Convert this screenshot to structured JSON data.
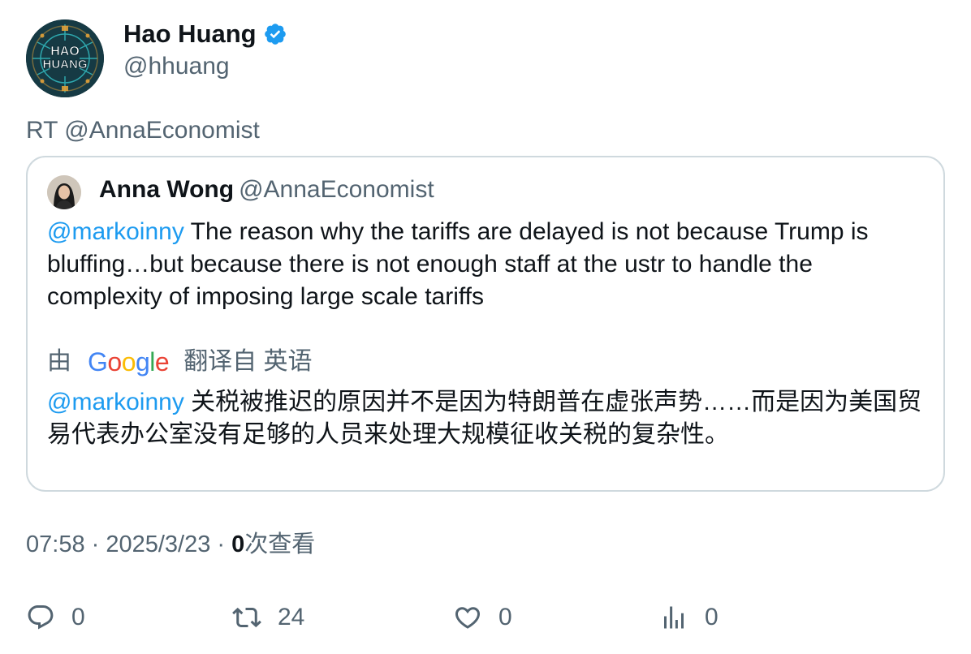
{
  "author": {
    "display_name": "Hao Huang",
    "handle": "@hhuang",
    "avatar_text_line1": "HAO",
    "avatar_text_line2": "HUANG",
    "verified_icon": "verified-badge-icon",
    "verified_color": "#1d9bf0"
  },
  "retweet_line": "RT @AnnaEconomist",
  "quote": {
    "display_name": "Anna Wong",
    "handle": "@AnnaEconomist",
    "mention": "@markoinny",
    "text": " The reason why the tariffs are delayed is not because Trump is bluffing…but because there is not enough staff at the ustr to handle the complexity of imposing large scale tariffs",
    "translation": {
      "prefix": "由",
      "provider_g1": "G",
      "provider_o1": "o",
      "provider_o2": "o",
      "provider_g2": "g",
      "provider_l": "l",
      "provider_e": "e",
      "suffix": "翻译自 英语",
      "mention": "@markoinny",
      "text": " 关税被推迟的原因并不是因为特朗普在虚张声势……而是因为美国贸易代表办公室没有足够的人员来处理大规模征收关税的复杂性。"
    }
  },
  "meta": {
    "time": "07:58",
    "separator": " · ",
    "date": "2025/3/23",
    "views_count": "0",
    "views_label": "次查看"
  },
  "actions": {
    "reply": {
      "icon": "reply-icon",
      "count": "0"
    },
    "retweet": {
      "icon": "retweet-icon",
      "count": "24"
    },
    "like": {
      "icon": "heart-icon",
      "count": "0"
    },
    "views": {
      "icon": "analytics-icon",
      "count": "0"
    }
  },
  "colors": {
    "accent": "#1d9bf0",
    "secondary_text": "#536471",
    "border": "#cfd9de"
  }
}
